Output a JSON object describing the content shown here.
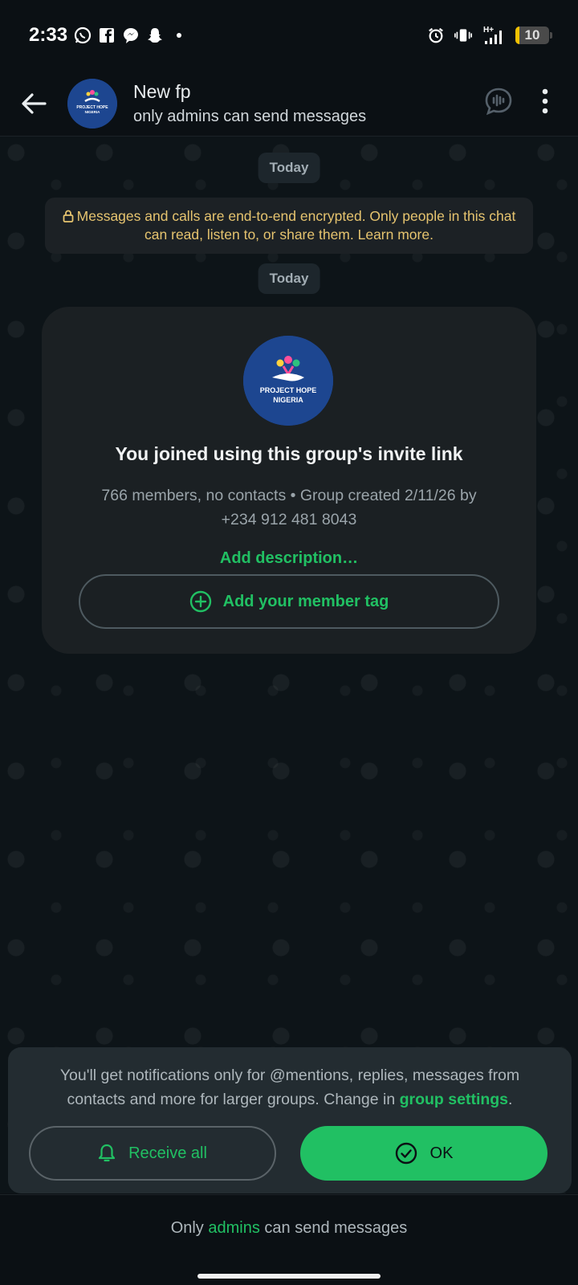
{
  "status_bar": {
    "time": "2:33",
    "battery": "10",
    "network": "H+"
  },
  "header": {
    "title": "New fp",
    "subtitle": "only admins can send messages"
  },
  "chat": {
    "date_pill_1": "Today",
    "encryption_notice": "Messages and calls are end-to-end encrypted. Only people in this chat can read, listen to, or share them. Learn more.",
    "date_pill_2": "Today",
    "group_card": {
      "logo_line1": "PROJECT HOPE",
      "logo_line2": "NIGERIA",
      "title": "You joined using this group's invite link",
      "meta": "766 members, no contacts • Group created 2/11/26 by +234 912 481 8043",
      "add_description": "Add description…",
      "member_tag_button": "Add your member tag"
    }
  },
  "notification_panel": {
    "text_prefix": "You'll get notifications only for @mentions, replies, messages from contacts and more for larger groups. Change in",
    "link": "group settings",
    "text_suffix": ".",
    "receive_all_label": "Receive all",
    "ok_label": "OK"
  },
  "footer": {
    "text_prefix": "Only",
    "link": "admins",
    "text_suffix": "can send messages"
  },
  "colors": {
    "accent": "#21c063",
    "encryption_text": "#e6c46f",
    "background": "#0b1014"
  }
}
